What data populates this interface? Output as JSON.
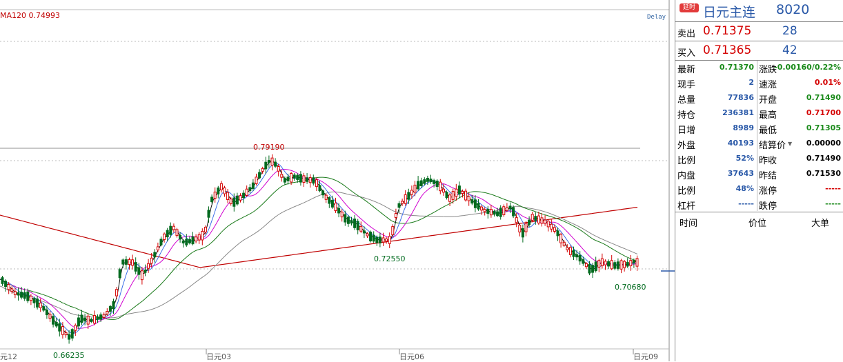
{
  "chart": {
    "ma_label": "MA120 0.74993",
    "delay_tag": "Delay",
    "high_label": "0.79190",
    "low_label_1": "0.66235",
    "mid_low_label": "0.72550",
    "low_label_2": "0.70680",
    "x_labels": [
      "元12",
      "日元03",
      "日元06",
      "日元09"
    ]
  },
  "chart_data": {
    "type": "candlestick",
    "annotations": [
      "0.79190",
      "0.66235",
      "0.72550",
      "0.70680"
    ],
    "x_labels": [
      "元12",
      "日元03",
      "日元06",
      "日元09"
    ],
    "ma_label": "MA120 0.74993",
    "last_price": "0.71370"
  },
  "panel": {
    "delay_badge": "延时",
    "name": "日元主连",
    "code": "8020",
    "sell_label": "卖出",
    "sell_price": "0.71375",
    "sell_vol": "28",
    "buy_label": "买入",
    "buy_price": "0.71365",
    "buy_vol": "42",
    "left_stats": [
      {
        "label": "最新",
        "value": "0.71370",
        "color": "#1a8a1a"
      },
      {
        "label": "现手",
        "value": "2",
        "color": "#2a59a8"
      },
      {
        "label": "总量",
        "value": "77836",
        "color": "#2a59a8"
      },
      {
        "label": "持仓",
        "value": "236381",
        "color": "#2a59a8"
      },
      {
        "label": "日增",
        "value": "8989",
        "color": "#2a59a8"
      },
      {
        "label": "外盘",
        "value": "40193",
        "color": "#2a59a8"
      },
      {
        "label": "比例",
        "value": "52%",
        "color": "#2a59a8"
      },
      {
        "label": "内盘",
        "value": "37643",
        "color": "#2a59a8"
      },
      {
        "label": "比例",
        "value": "48%",
        "color": "#2a59a8"
      },
      {
        "label": "杠杆",
        "value": "-----",
        "color": "#2a59a8"
      }
    ],
    "right_stats": [
      {
        "label": "涨跌",
        "value": "-0.00160/0.22%",
        "color": "#1a8a1a"
      },
      {
        "label": "速涨",
        "value": "0.01%",
        "color": "#d40000"
      },
      {
        "label": "开盘",
        "value": "0.71490",
        "color": "#1a8a1a"
      },
      {
        "label": "最高",
        "value": "0.71700",
        "color": "#d40000"
      },
      {
        "label": "最低",
        "value": "0.71305",
        "color": "#1a8a1a"
      },
      {
        "label": "结算价",
        "value": "0.00000",
        "color": "#000000"
      },
      {
        "label": "昨收",
        "value": "0.71490",
        "color": "#000000"
      },
      {
        "label": "昨结",
        "value": "0.71530",
        "color": "#000000"
      },
      {
        "label": "涨停",
        "value": "-----",
        "color": "#d40000"
      },
      {
        "label": "跌停",
        "value": "-----",
        "color": "#1a8a1a"
      }
    ],
    "ticks_header": {
      "time": "时间",
      "price": "价位",
      "volume": "大单"
    }
  }
}
